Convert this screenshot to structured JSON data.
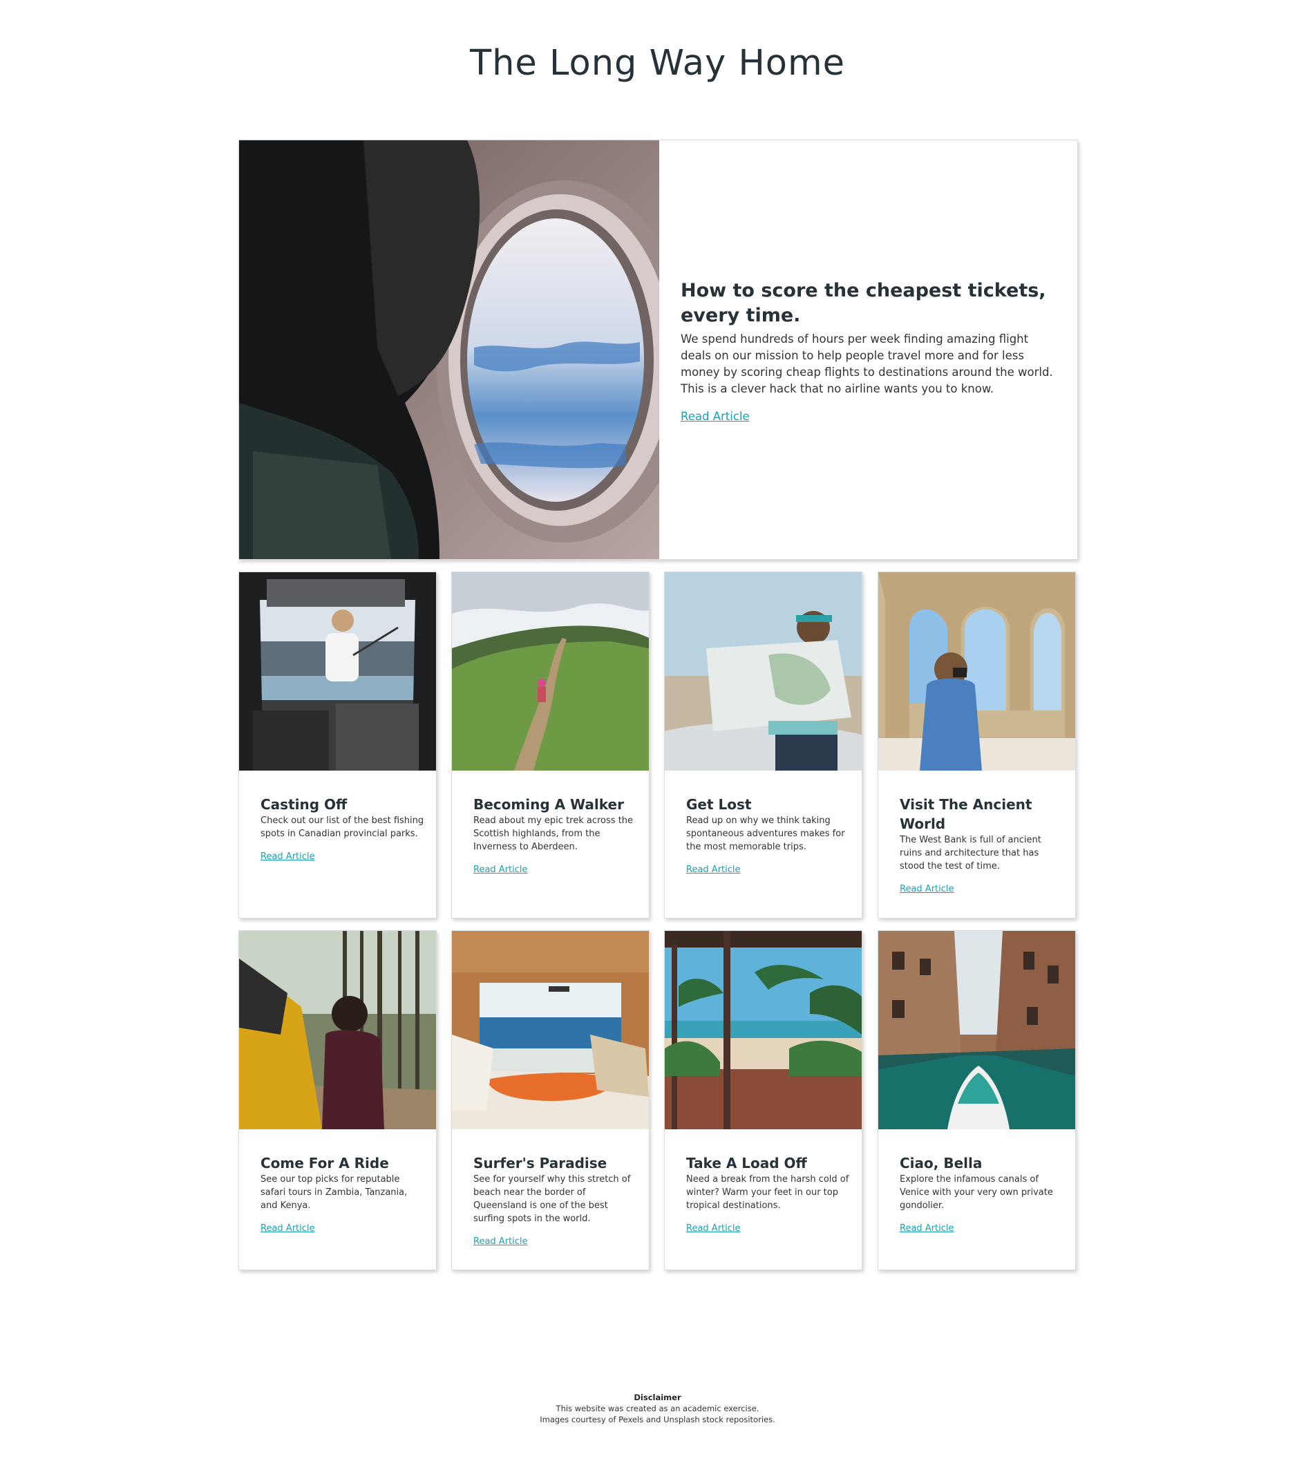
{
  "site": {
    "title": "The Long Way Home"
  },
  "featured": {
    "image_icon": "airplane-window-photo",
    "heading": "How to score the cheapest tickets, every time.",
    "description": "We spend hundreds of hours per week finding amazing flight deals on our mission to help people travel more and for less money by scoring cheap flights to destinations around the world. This is a clever hack that no airline wants you to know.",
    "link_label": "Read Article"
  },
  "articles": [
    {
      "image_icon": "fishing-van-photo",
      "heading": "Casting Off",
      "description": "Check out our list of the best fishing spots in Canadian provincial parks.",
      "link_label": "Read Article"
    },
    {
      "image_icon": "hiking-trail-photo",
      "heading": "Becoming A Walker",
      "description": "Read about my epic trek across the Scottish highlands, from the Inverness to Aberdeen.",
      "link_label": "Read Article"
    },
    {
      "image_icon": "map-reader-photo",
      "heading": "Get Lost",
      "description": "Read up on why we think taking spontaneous adventures makes for the most memorable trips.",
      "link_label": "Read Article"
    },
    {
      "image_icon": "ancient-arches-photo",
      "heading": "Visit The Ancient World",
      "description": "The West Bank is full of ancient ruins and architecture that has stood the test of time.",
      "link_label": "Read Article"
    },
    {
      "image_icon": "forest-van-photo",
      "heading": "Come For A Ride",
      "description": "See our top picks for reputable safari tours in Zambia, Tanzania, and Kenya.",
      "link_label": "Read Article"
    },
    {
      "image_icon": "beach-van-surfboard-photo",
      "heading": "Surfer's Paradise",
      "description": "See for yourself why this stretch of beach near the border of Queensland is one of the best surfing spots in the world.",
      "link_label": "Read Article"
    },
    {
      "image_icon": "tropical-beach-photo",
      "heading": "Take A Load Off",
      "description": "Need a break from the harsh cold of winter? Warm your feet in our top tropical destinations.",
      "link_label": "Read Article"
    },
    {
      "image_icon": "venice-canal-photo",
      "heading": "Ciao, Bella",
      "description": "Explore the infamous canals of Venice with your very own private gondolier.",
      "link_label": "Read Article"
    }
  ],
  "footer": {
    "title": "Disclaimer",
    "line1": "This website was created as an academic exercise.",
    "line2": "Images courtesy of Pexels and Unsplash stock repositories."
  },
  "colors": {
    "link": "#17a2b8",
    "heading": "#263238",
    "border": "#d8dde0"
  }
}
